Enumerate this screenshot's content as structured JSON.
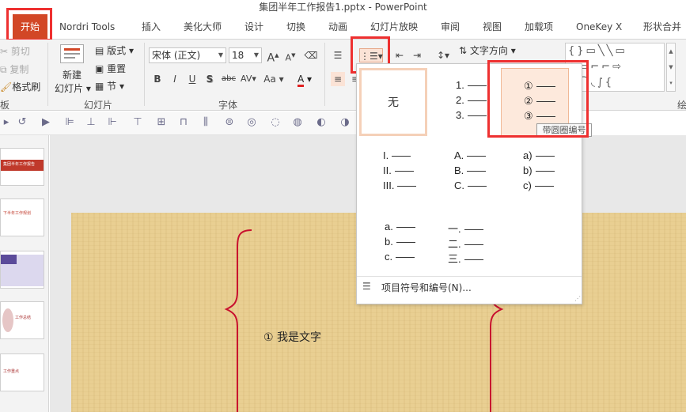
{
  "window": {
    "title": "集团半年工作报告1.pptx - PowerPoint"
  },
  "tabs": [
    "开始",
    "Nordri Tools",
    "插入",
    "美化大师",
    "设计",
    "切换",
    "动画",
    "幻灯片放映",
    "审阅",
    "视图",
    "加载项",
    "OneKey X",
    "形状合并"
  ],
  "ribbon": {
    "clipboard": {
      "cut": "剪切",
      "copy": "复制",
      "format_painter": "格式刷",
      "group": "板"
    },
    "slides": {
      "new_slide_line1": "新建",
      "new_slide_line2": "幻灯片",
      "layout": "版式",
      "reset": "重置",
      "section": "节",
      "group": "幻灯片"
    },
    "font": {
      "name": "宋体 (正文)",
      "size": "18",
      "group": "字体",
      "bold": "B",
      "italic": "I",
      "underline": "U",
      "shadow": "S",
      "strike": "abc",
      "spacing": "AV",
      "case": "Aa",
      "color": "A",
      "grow": "A",
      "shrink": "A"
    },
    "paragraph": {
      "text_direction": "文字方向"
    },
    "drawing": {
      "group": "绘"
    }
  },
  "numbering_menu": {
    "none": "无",
    "arabic": [
      "1.",
      "2.",
      "3."
    ],
    "circled": [
      "①",
      "②",
      "③"
    ],
    "roman": [
      "I.",
      "II.",
      "III."
    ],
    "upper_alpha": [
      "A.",
      "B.",
      "C."
    ],
    "lower_paren": [
      "a)",
      "b)",
      "c)"
    ],
    "lower_alpha": [
      "a.",
      "b.",
      "c."
    ],
    "chinese": [
      "一.",
      "二.",
      "三."
    ],
    "footer": "项目符号和编号(N)...",
    "tooltip": "带圆圈编号"
  },
  "slide": {
    "text": "①  我是文字"
  },
  "thumbnails": [
    "集团半年工作报告",
    "下半年工作规划",
    "",
    "工作总结",
    "工作重点"
  ],
  "colors": {
    "accent": "#d24726",
    "highlight": "#ee3030"
  }
}
